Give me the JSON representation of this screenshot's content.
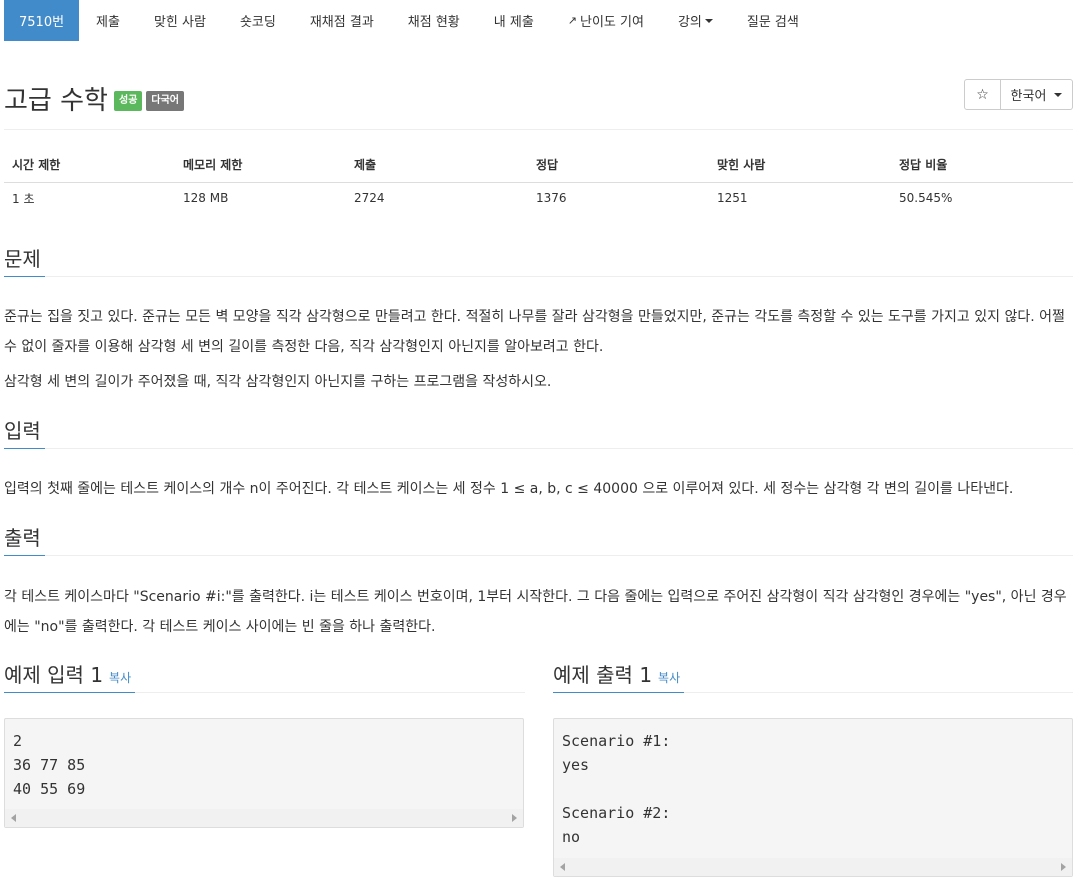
{
  "nav": {
    "tabs": [
      {
        "label": "7510번"
      },
      {
        "label": "제출"
      },
      {
        "label": "맞힌 사람"
      },
      {
        "label": "숏코딩"
      },
      {
        "label": "재채점 결과"
      },
      {
        "label": "채점 현황"
      },
      {
        "label": "내 제출"
      },
      {
        "label": "난이도 기여"
      },
      {
        "label": "강의"
      },
      {
        "label": "질문 검색"
      }
    ]
  },
  "problem": {
    "title": "고급 수학",
    "badge_success": "성공",
    "badge_multilang": "다국어",
    "star": "☆",
    "language": "한국어"
  },
  "info_table": {
    "headers": [
      "시간 제한",
      "메모리 제한",
      "제출",
      "정답",
      "맞힌 사람",
      "정답 비율"
    ],
    "values": [
      "1 초",
      "128 MB",
      "2724",
      "1376",
      "1251",
      "50.545%"
    ]
  },
  "sections": {
    "description": {
      "heading": "문제",
      "paragraphs": [
        "준규는 집을 짓고 있다. 준규는 모든 벽 모양을 직각 삼각형으로 만들려고 한다. 적절히 나무를 잘라 삼각형을 만들었지만, 준규는 각도를 측정할 수 있는 도구를 가지고 있지 않다. 어쩔 수 없이 줄자를 이용해 삼각형 세 변의 길이를 측정한 다음, 직각 삼각형인지 아닌지를 알아보려고 한다.",
        "삼각형 세 변의 길이가 주어졌을 때, 직각 삼각형인지 아닌지를 구하는 프로그램을 작성하시오."
      ]
    },
    "input": {
      "heading": "입력",
      "text": "입력의 첫째 줄에는 테스트 케이스의 개수 n이 주어진다. 각 테스트 케이스는 세 정수 1 ≤ a, b, c ≤ 40000 으로 이루어져 있다. 세 정수는 삼각형 각 변의 길이를 나타낸다."
    },
    "output": {
      "heading": "출력",
      "text": "각 테스트 케이스마다 \"Scenario #i:\"를 출력한다. i는 테스트 케이스 번호이며, 1부터 시작한다. 그 다음 줄에는 입력으로 주어진 삼각형이 직각 삼각형인 경우에는 \"yes\", 아닌 경우에는 \"no\"를 출력한다. 각 테스트 케이스 사이에는 빈 줄을 하나 출력한다."
    }
  },
  "samples": {
    "input": {
      "heading": "예제 입력 1",
      "copy": "복사",
      "content": "2\n36 77 85\n40 55 69"
    },
    "output": {
      "heading": "예제 출력 1",
      "copy": "복사",
      "content": "Scenario #1:\nyes\n\nScenario #2:\nno"
    }
  }
}
